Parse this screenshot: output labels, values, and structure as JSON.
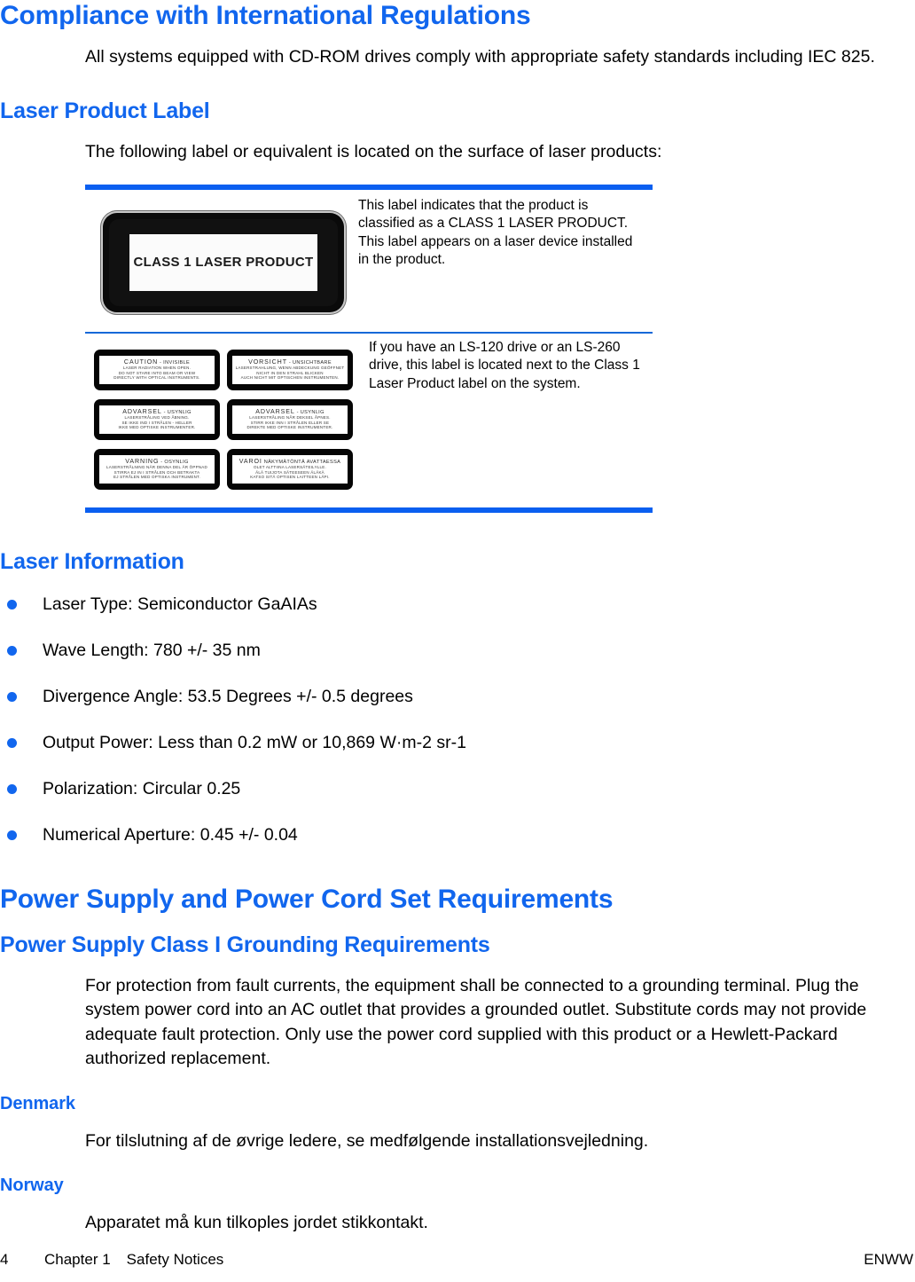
{
  "page": {
    "accent_color": "#1166ee",
    "rule_color": "#0a5ff0",
    "bullet_color": "#1166ee"
  },
  "sections": {
    "compliance": {
      "heading": "Compliance with International Regulations",
      "paragraph": "All systems equipped with CD-ROM drives comply with appropriate safety standards including IEC 825."
    },
    "laser_product_label": {
      "heading": "Laser Product Label",
      "paragraph": "The following label or equivalent is located on the surface of laser products:",
      "figure": {
        "class1_label": {
          "plate_text": "CLASS 1 LASER PRODUCT",
          "caption": "This label indicates that the product is classified as a CLASS 1 LASER PRODUCT. This label appears on a laser device installed in the product."
        },
        "multilingual_labels": {
          "caption": "If you have an LS-120 drive or an LS-260 drive, this label is located next to the Class 1 Laser Product label on the system.",
          "labels": [
            {
              "language": "English",
              "title": "CAUTION",
              "subtitle": "- INVISIBLE",
              "lines": [
                "LASER RADIATION WHEN OPEN.",
                "DO NOT STARE INTO BEAM OR VIEW",
                "DIRECTLY WITH OPTICAL INSTRUMENTS."
              ]
            },
            {
              "language": "German",
              "title": "VORSICHT",
              "subtitle": "- UNSICHTBARE",
              "lines": [
                "LASERSTRAHLUNG, WENN ABDECKUNG GEÖFFNET",
                "NICHT IN DEN STRAHL BLICKEN",
                "AUCH NICHT MIT OPTISCHEN INSTRUMENTEN."
              ]
            },
            {
              "language": "Danish",
              "title": "ADVARSEL",
              "subtitle": "- USYNLIG",
              "lines": [
                "LASERSTRÅLING VED ÅBNING.",
                "SE IKKE IND I STRÅLEN - HELLER",
                "IKKE MED OPTISKE INSTRUMENTER."
              ]
            },
            {
              "language": "Norwegian",
              "title": "ADVARSEL",
              "subtitle": "- USYNLIG",
              "lines": [
                "LASERSTRÅLING NÅR DEKSEL ÅPNES.",
                "STIRR IKKE INN I STRÅLEN ELLER SE",
                "DIREKTE MED OPTISKE INSTRUMENTER."
              ]
            },
            {
              "language": "Swedish",
              "title": "VARNING",
              "subtitle": "- OSYNLIG",
              "lines": [
                "LASERSTRÅLNING NÄR DENNA DEL ÄR ÖPPNAD",
                "STIRRA EJ IN I STRÅLEN OCH BETRAKTA",
                "EJ STRÅLEN MED OPTISKA INSTRUMENT."
              ]
            },
            {
              "language": "Finnish",
              "title": "VAROI",
              "subtitle": "NÄKYMÄTÖNTÄ AVATTAESSA",
              "lines": [
                "OLET ALTTIINA LASERSÄTEILYLLE.",
                "ÄLÄ TUIJOTA SÄTEESEEN ÄLÄKÄ",
                "KATSO SITÄ OPTISEN LAITTEEN LÄPI."
              ]
            }
          ]
        }
      }
    },
    "laser_information": {
      "heading": "Laser Information",
      "bullets": [
        "Laser Type: Semiconductor GaAIAs",
        "Wave Length: 780 +/- 35 nm",
        "Divergence Angle: 53.5 Degrees +/- 0.5 degrees",
        "Output Power: Less than 0.2 mW or 10,869 W·m-2 sr-1",
        "Polarization: Circular 0.25",
        "Numerical Aperture: 0.45 +/- 0.04"
      ]
    },
    "power_supply": {
      "heading": "Power Supply and Power Cord Set Requirements",
      "grounding": {
        "heading": "Power Supply Class I Grounding Requirements",
        "paragraph": "For protection from fault currents, the equipment shall be connected to a grounding terminal. Plug the system power cord into an AC outlet that provides a grounded outlet. Substitute cords may not provide adequate fault protection. Only use the power cord supplied with this product or a Hewlett-Packard authorized replacement."
      },
      "denmark": {
        "heading": "Denmark",
        "paragraph": "For tilslutning af de øvrige ledere, se medfølgende installationsvejledning."
      },
      "norway": {
        "heading": "Norway",
        "paragraph": "Apparatet må kun tilkoples jordet stikkontakt."
      }
    }
  },
  "footer": {
    "page_number": "4",
    "chapter": "Chapter 1",
    "chapter_title": "Safety Notices",
    "right": "ENWW"
  }
}
